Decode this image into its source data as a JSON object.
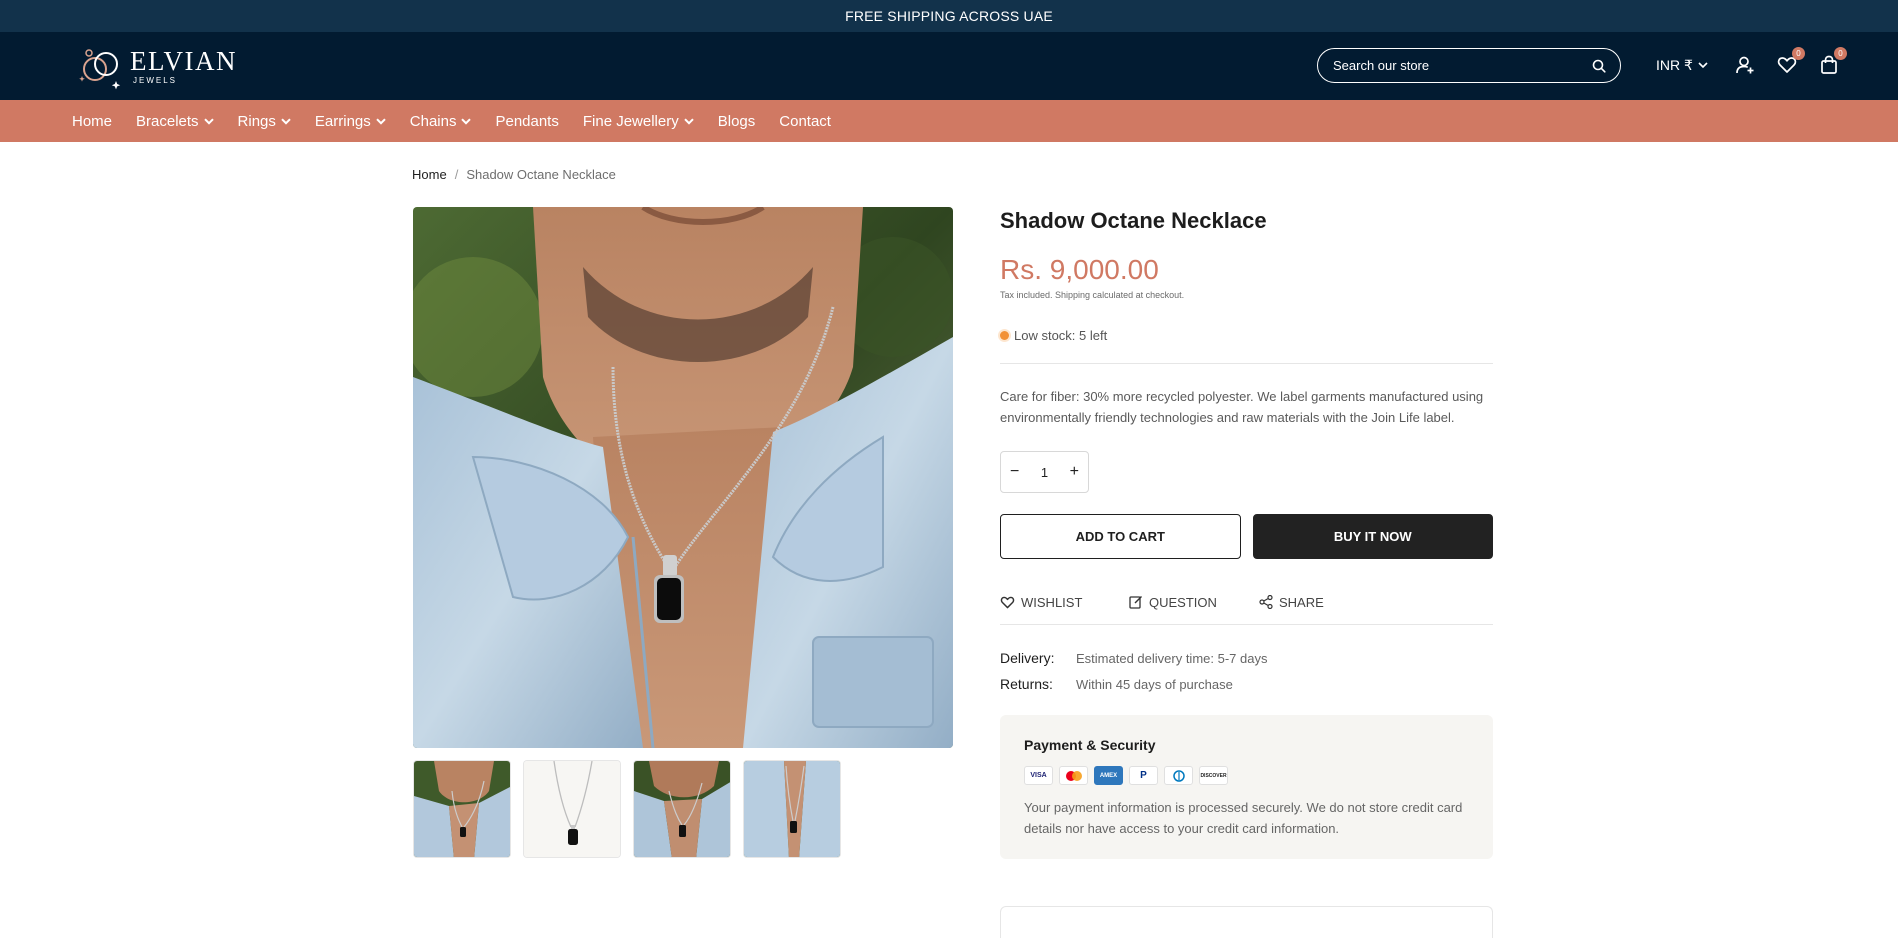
{
  "announcement": "FREE SHIPPING ACROSS UAE",
  "header": {
    "logo_name": "ELVIAN",
    "logo_sub": "JEWELS",
    "search_placeholder": "Search our store",
    "currency": "INR ₹",
    "wishlist_count": "0",
    "cart_count": "0"
  },
  "nav": {
    "items": [
      {
        "label": "Home",
        "dropdown": false
      },
      {
        "label": "Bracelets",
        "dropdown": true
      },
      {
        "label": "Rings",
        "dropdown": true
      },
      {
        "label": "Earrings",
        "dropdown": true
      },
      {
        "label": "Chains",
        "dropdown": true
      },
      {
        "label": "Pendants",
        "dropdown": false
      },
      {
        "label": "Fine Jewellery",
        "dropdown": true
      },
      {
        "label": "Blogs",
        "dropdown": false
      },
      {
        "label": "Contact",
        "dropdown": false
      }
    ]
  },
  "breadcrumb": {
    "home": "Home",
    "separator": "/",
    "current": "Shadow Octane Necklace"
  },
  "product": {
    "title": "Shadow Octane Necklace",
    "price": "Rs. 9,000.00",
    "tax_note": "Tax included. Shipping calculated at checkout.",
    "stock": "Low stock: 5 left",
    "description": "Care for fiber: 30% more recycled polyester. We label garments manufactured using environmentally friendly technologies and raw materials with the Join Life label.",
    "quantity": "1",
    "add_to_cart": "ADD TO CART",
    "buy_now": "BUY IT NOW"
  },
  "actions": {
    "wishlist": "WISHLIST",
    "question": "QUESTION",
    "share": "SHARE"
  },
  "meta": {
    "delivery_label": "Delivery:",
    "delivery_value": "Estimated delivery time: 5-7 days",
    "returns_label": "Returns:",
    "returns_value": "Within 45 days of purchase"
  },
  "payment": {
    "title": "Payment & Security",
    "cards": [
      "VISA",
      "Mastercard",
      "AMEX",
      "PayPal",
      "Diners",
      "DISCOVER"
    ],
    "text": "Your payment information is processed securely. We do not store credit card details nor have access to your credit card information."
  },
  "colors": {
    "announcement_bg": "#12324b",
    "header_bg": "#021b31",
    "nav_bg": "#d07963",
    "price": "#d07963",
    "buy_now_bg": "#222222"
  }
}
